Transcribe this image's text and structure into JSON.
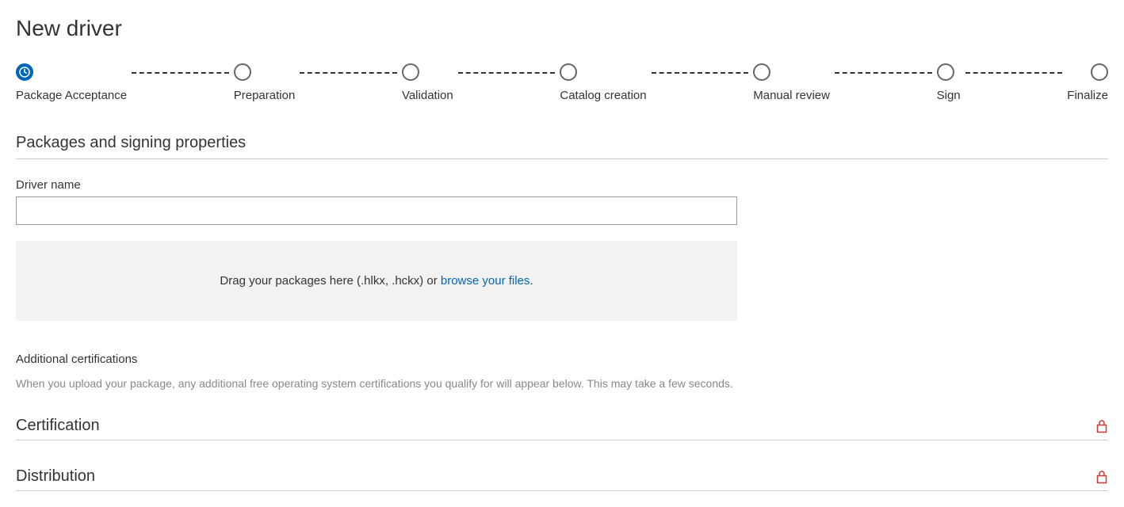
{
  "page_title": "New driver",
  "stepper": [
    {
      "label": "Package Acceptance",
      "active": true
    },
    {
      "label": "Preparation",
      "active": false
    },
    {
      "label": "Validation",
      "active": false
    },
    {
      "label": "Catalog creation",
      "active": false
    },
    {
      "label": "Manual review",
      "active": false
    },
    {
      "label": "Sign",
      "active": false
    },
    {
      "label": "Finalize",
      "active": false
    }
  ],
  "section1_heading": "Packages and signing properties",
  "driver_name_label": "Driver name",
  "driver_name_value": "",
  "dropzone_prefix": "Drag your packages here (.hlkx, .hckx)  or ",
  "dropzone_link": "browse your files",
  "dropzone_suffix": ".",
  "additional_cert_heading": "Additional certifications",
  "additional_cert_help": "When you upload your package, any additional free operating system certifications you qualify for will appear below. This may take a few seconds.",
  "certification_heading": "Certification",
  "distribution_heading": "Distribution"
}
